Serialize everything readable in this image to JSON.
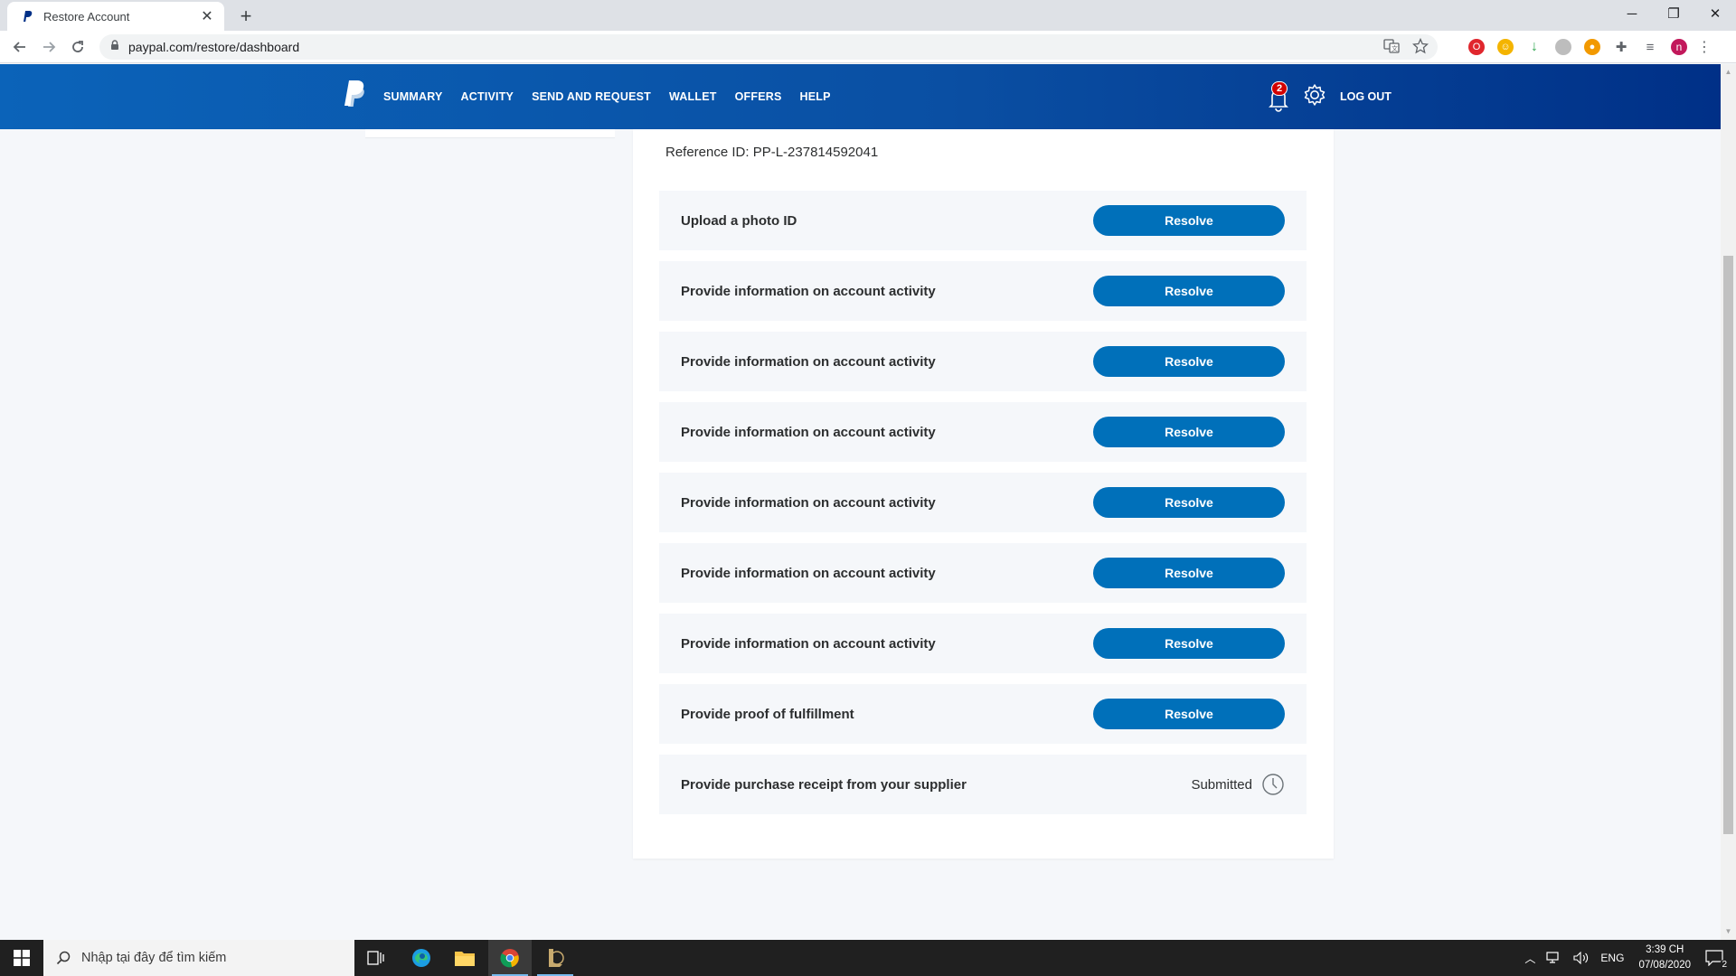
{
  "browser": {
    "tab_title": "Restore Account",
    "url": "paypal.com/restore/dashboard",
    "profile_initial": "n"
  },
  "header": {
    "nav": [
      "SUMMARY",
      "ACTIVITY",
      "SEND AND REQUEST",
      "WALLET",
      "OFFERS",
      "HELP"
    ],
    "notifications_count": "2",
    "logout_label": "LOG OUT"
  },
  "content": {
    "reference_id": "Reference ID: PP-L-237814592041",
    "tasks": [
      {
        "label": "Upload a photo ID",
        "action": "Resolve"
      },
      {
        "label": "Provide information on account activity",
        "action": "Resolve"
      },
      {
        "label": "Provide information on account activity",
        "action": "Resolve"
      },
      {
        "label": "Provide information on account activity",
        "action": "Resolve"
      },
      {
        "label": "Provide information on account activity",
        "action": "Resolve"
      },
      {
        "label": "Provide information on account activity",
        "action": "Resolve"
      },
      {
        "label": "Provide information on account activity",
        "action": "Resolve"
      },
      {
        "label": "Provide proof of fulfillment",
        "action": "Resolve"
      }
    ],
    "submitted_task": {
      "label": "Provide purchase receipt from your supplier",
      "status": "Submitted"
    }
  },
  "taskbar": {
    "search_placeholder": "Nhập tại đây để tìm kiếm",
    "language": "ENG",
    "time": "3:39 CH",
    "date": "07/08/2020",
    "notification_count": "2"
  },
  "colors": {
    "header_start": "#0b63b9",
    "header_end": "#003087",
    "button": "#0070ba",
    "row_bg": "#f5f7fa"
  }
}
